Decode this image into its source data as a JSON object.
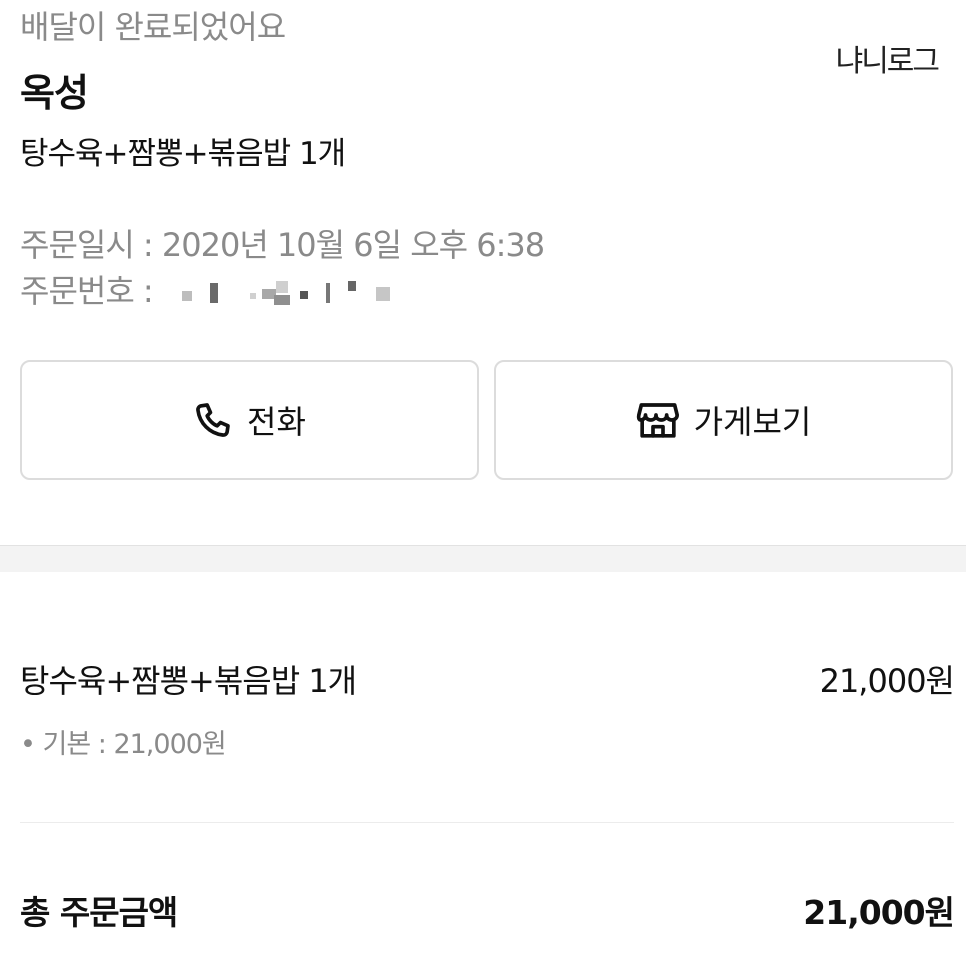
{
  "header": {
    "status_text": "배달이 완료되었어요",
    "watermark": "냐니로그",
    "store_name": "옥성",
    "menu_summary": "탕수육+짬뽕+볶음밥 1개"
  },
  "order": {
    "datetime": "주문일시 : 2020년 10월 6일 오후 6:38",
    "number_label": "주문번호 :"
  },
  "actions": {
    "call_label": "전화",
    "store_label": "가게보기",
    "call_icon": "phone-icon",
    "store_icon": "storefront-icon"
  },
  "items": [
    {
      "name": "탕수육+짬뽕+볶음밥 1개",
      "price": "21,000원",
      "option": "• 기본 : 21,000원"
    }
  ],
  "total": {
    "label": "총 주문금액",
    "amount": "21,000원"
  }
}
